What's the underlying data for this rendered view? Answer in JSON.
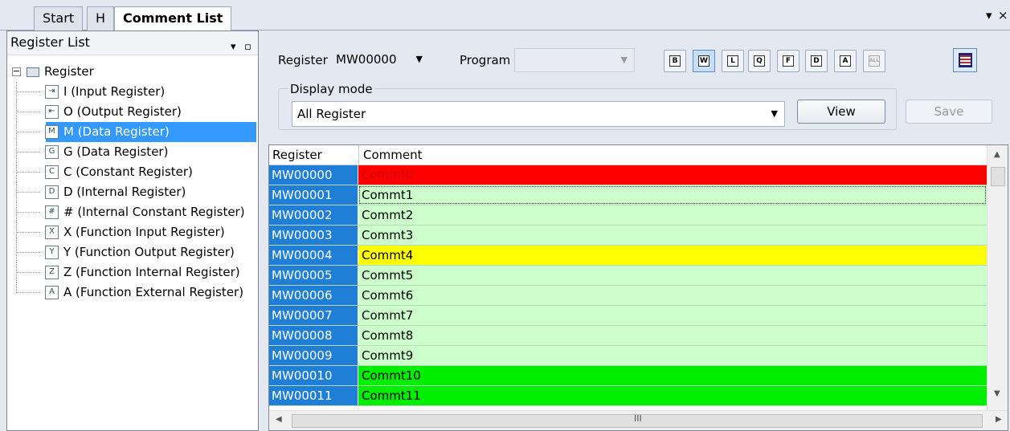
{
  "tabs": [
    {
      "label": "Start",
      "active": false
    },
    {
      "label": "H",
      "active": false
    },
    {
      "label": "Comment List",
      "active": true
    }
  ],
  "window_controls": {
    "pin": "▾",
    "close": "×"
  },
  "left_pane": {
    "title": "Register List",
    "root": "Register",
    "items": [
      {
        "label": "I (Input Register)",
        "icon": "input-register-icon",
        "glyph": "⇥"
      },
      {
        "label": "O (Output Register)",
        "icon": "output-register-icon",
        "glyph": "⇤"
      },
      {
        "label": "M (Data Register)",
        "icon": "data-register-icon",
        "glyph": "M",
        "selected": true
      },
      {
        "label": "G (Data Register)",
        "icon": "global-register-icon",
        "glyph": "G"
      },
      {
        "label": "C (Constant Register)",
        "icon": "constant-register-icon",
        "glyph": "C"
      },
      {
        "label": "D (Internal Register)",
        "icon": "internal-register-icon",
        "glyph": "D"
      },
      {
        "label": "# (Internal Constant Register)",
        "icon": "internal-constant-register-icon",
        "glyph": "#"
      },
      {
        "label": "X (Function Input Register)",
        "icon": "function-input-register-icon",
        "glyph": "X"
      },
      {
        "label": "Y (Function Output Register)",
        "icon": "function-output-register-icon",
        "glyph": "Y"
      },
      {
        "label": "Z (Function Internal Register)",
        "icon": "function-internal-register-icon",
        "glyph": "Z"
      },
      {
        "label": "A (Function External Register)",
        "icon": "function-external-register-icon",
        "glyph": "A"
      }
    ]
  },
  "toolbar": {
    "register_label": "Register",
    "register_value": "MW00000",
    "program_label": "Program",
    "program_value": "",
    "type_buttons": [
      {
        "glyph": "B",
        "name": "b-register-button",
        "active": false,
        "disabled": false
      },
      {
        "glyph": "W",
        "name": "w-register-button",
        "active": true,
        "disabled": false
      },
      {
        "glyph": "L",
        "name": "l-register-button",
        "active": false,
        "disabled": false
      },
      {
        "glyph": "Q",
        "name": "q-register-button",
        "active": false,
        "disabled": false
      },
      {
        "glyph": "F",
        "name": "f-register-button",
        "active": false,
        "disabled": false
      },
      {
        "glyph": "D",
        "name": "d-register-button",
        "active": false,
        "disabled": false
      },
      {
        "glyph": "A",
        "name": "a-register-button",
        "active": false,
        "disabled": false
      },
      {
        "glyph": "ALL",
        "name": "all-register-button",
        "active": false,
        "disabled": true
      }
    ],
    "display_mode_label": "Display mode",
    "display_mode_value": "All Register",
    "view_label": "View",
    "save_label": "Save"
  },
  "grid": {
    "headers": [
      "Register",
      "Comment"
    ],
    "rows": [
      {
        "register": "MW00000",
        "comment": "Commt0",
        "color": "#ff0000",
        "text_color": "#cc0000"
      },
      {
        "register": "MW00001",
        "comment": "Commt1",
        "color": "#ccffcc",
        "text_color": "#000000",
        "focused": true
      },
      {
        "register": "MW00002",
        "comment": "Commt2",
        "color": "#ccffcc",
        "text_color": "#000000"
      },
      {
        "register": "MW00003",
        "comment": "Commt3",
        "color": "#ccffcc",
        "text_color": "#000000"
      },
      {
        "register": "MW00004",
        "comment": "Commt4",
        "color": "#ffff00",
        "text_color": "#000000"
      },
      {
        "register": "MW00005",
        "comment": "Commt5",
        "color": "#ccffcc",
        "text_color": "#000000"
      },
      {
        "register": "MW00006",
        "comment": "Commt6",
        "color": "#ccffcc",
        "text_color": "#000000"
      },
      {
        "register": "MW00007",
        "comment": "Commt7",
        "color": "#ccffcc",
        "text_color": "#000000"
      },
      {
        "register": "MW00008",
        "comment": "Commt8",
        "color": "#ccffcc",
        "text_color": "#000000"
      },
      {
        "register": "MW00009",
        "comment": "Commt9",
        "color": "#ccffcc",
        "text_color": "#000000"
      },
      {
        "register": "MW00010",
        "comment": "Commt10",
        "color": "#00ee00",
        "text_color": "#000000"
      },
      {
        "register": "MW00011",
        "comment": "Commt11",
        "color": "#00ee00",
        "text_color": "#000000"
      }
    ],
    "hscroll_grip": "III"
  }
}
